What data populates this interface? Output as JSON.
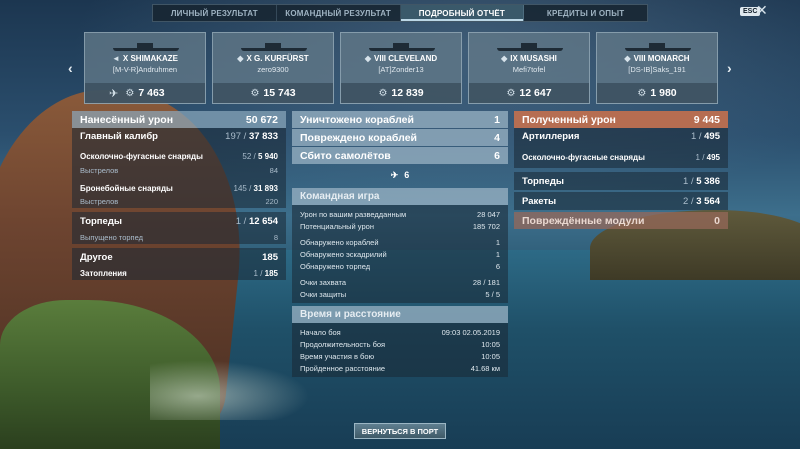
{
  "tabs": [
    {
      "label": "ЛИЧНЫЙ РЕЗУЛЬТАТ",
      "active": false
    },
    {
      "label": "КОМАНДНЫЙ РЕЗУЛЬТАТ",
      "active": false
    },
    {
      "label": "ПОДРОБНЫЙ ОТЧЁТ",
      "active": true
    },
    {
      "label": "КРЕДИТЫ И ОПЫТ",
      "active": false
    }
  ],
  "esc_label": "ESC",
  "close_glyph": "✕",
  "nav": {
    "prev": "‹",
    "next": "›"
  },
  "ships": [
    {
      "name": "X SHIMAKAZE",
      "player": "[M-V-R]Andruhmen",
      "damage": "7 463",
      "destroyed": true
    },
    {
      "name": "X G. KURFÜRST",
      "player": "zero9300",
      "damage": "15 743",
      "destroyed": false
    },
    {
      "name": "VIII CLEVELAND",
      "player": "[AT]Zonder13",
      "damage": "12 839",
      "destroyed": false
    },
    {
      "name": "IX MUSASHI",
      "player": "Mefi7tofel",
      "damage": "12 647",
      "destroyed": false
    },
    {
      "name": "VIII MONARCH",
      "player": "[DS-IB]Saks_191",
      "damage": "1 980",
      "destroyed": false
    }
  ],
  "dealt": {
    "title": "Нанесённый урон",
    "total": "50 672",
    "main_battery": {
      "label": "Главный калибр",
      "value": "197 / ",
      "value_b": "37 833"
    },
    "he": {
      "label": "Осколочно-фугасные снаряды",
      "value": "52 / ",
      "value_b": "5 940"
    },
    "he_shots": {
      "label": "Выстрелов",
      "value": "84"
    },
    "ap": {
      "label": "Бронебойные снаряды",
      "value": "145 / ",
      "value_b": "31 893"
    },
    "ap_shots": {
      "label": "Выстрелов",
      "value": "220"
    },
    "torpedoes": {
      "label": "Торпеды",
      "value": "1 / ",
      "value_b": "12 654"
    },
    "torp_launched": {
      "label": "Выпущено торпед",
      "value": "8"
    },
    "other": {
      "label": "Другое",
      "value": "185"
    },
    "flooding": {
      "label": "Затопления",
      "value": "1 / ",
      "value_b": "185"
    }
  },
  "kills": {
    "ships_destroyed": {
      "label": "Уничтожено кораблей",
      "value": "1"
    },
    "ships_damaged": {
      "label": "Повреждено кораблей",
      "value": "4"
    },
    "planes": {
      "label": "Сбито самолётов",
      "value": "6"
    },
    "plane_count": "6"
  },
  "team": {
    "title": "Командная игра",
    "spotting_dmg": {
      "label": "Урон по вашим разведданным",
      "value": "28 047"
    },
    "potential_dmg": {
      "label": "Потенциальный урон",
      "value": "185 702"
    },
    "ships_spotted": {
      "label": "Обнаружено кораблей",
      "value": "1"
    },
    "squadrons_spotted": {
      "label": "Обнаружено эскадрилий",
      "value": "1"
    },
    "torps_spotted": {
      "label": "Обнаружено торпед",
      "value": "6"
    },
    "capture_pts": {
      "label": "Очки захвата",
      "value": "28 / 181"
    },
    "defense_pts": {
      "label": "Очки защиты",
      "value": "5 / 5"
    }
  },
  "time": {
    "title": "Время и расстояние",
    "start": {
      "label": "Начало боя",
      "value": "09:03  02.05.2019"
    },
    "duration": {
      "label": "Продолжительность боя",
      "value": "10:05"
    },
    "participation": {
      "label": "Время участия в бою",
      "value": "10:05"
    },
    "distance": {
      "label": "Пройденное расстояние",
      "value": "41.68 км"
    }
  },
  "received": {
    "title": "Полученный урон",
    "total": "9 445",
    "artillery": {
      "label": "Артиллерия",
      "value": "1 / ",
      "value_b": "495"
    },
    "he": {
      "label": "Осколочно-фугасные снаряды",
      "value": "1 / ",
      "value_b": "495"
    },
    "torpedoes": {
      "label": "Торпеды",
      "value": "1 / ",
      "value_b": "5 386"
    },
    "rockets": {
      "label": "Ракеты",
      "value": "2 / ",
      "value_b": "3 564"
    },
    "modules": {
      "label": "Повреждённые модули",
      "value": "0"
    }
  },
  "return_button": "ВЕРНУТЬСЯ В ПОРТ"
}
